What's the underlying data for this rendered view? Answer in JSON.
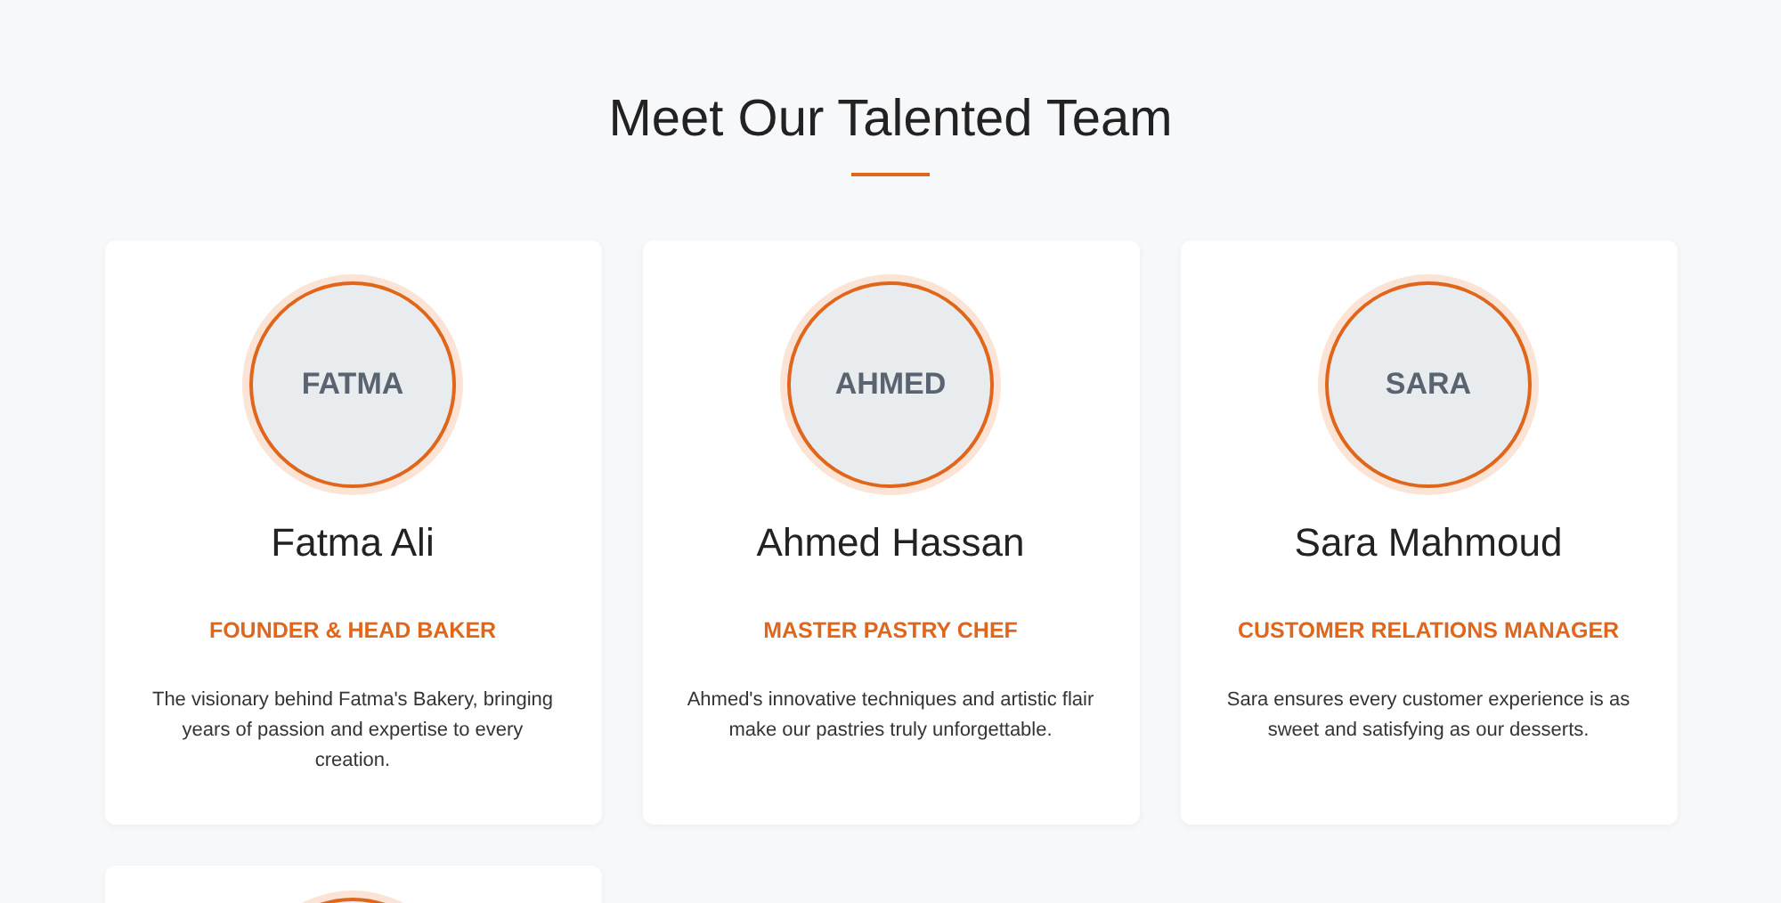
{
  "heading": "Meet Our Talented Team",
  "members": [
    {
      "kind": "full",
      "initials": "FATMA",
      "name": "Fatma Ali",
      "role": "FOUNDER & HEAD BAKER",
      "bio": "The visionary behind Fatma's Bakery, bringing years of passion and expertise to every creation."
    },
    {
      "kind": "full",
      "initials": "AHMED",
      "name": "Ahmed Hassan",
      "role": "MASTER PASTRY CHEF",
      "bio": "Ahmed's innovative techniques and artistic flair make our pastries truly unforgettable."
    },
    {
      "kind": "full",
      "initials": "SARA",
      "name": "Sara Mahmoud",
      "role": "CUSTOMER RELATIONS MANAGER",
      "bio": "Sara ensures every customer experience is as sweet and satisfying as our desserts."
    },
    {
      "kind": "cut"
    }
  ]
}
